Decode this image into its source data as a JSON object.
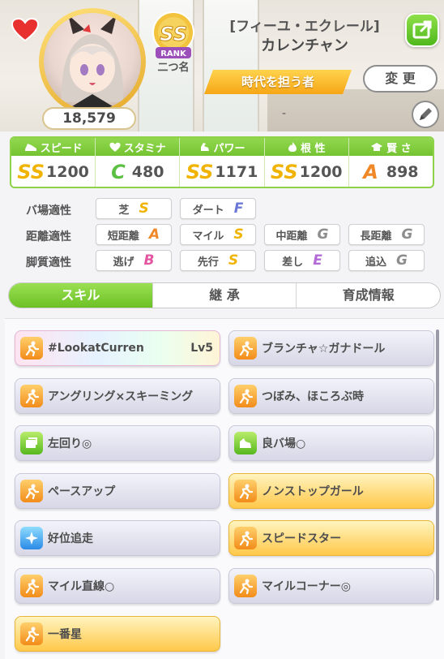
{
  "header": {
    "fans": "18,579",
    "rank_badge_text": "SS",
    "rank_sub_text": "RANK",
    "rank_label": "二つ名",
    "costume": "[フィーユ・エクレール]",
    "name": "カレンチャン",
    "epithet": "時代を担う者",
    "change_label": "変 更",
    "memo": "-"
  },
  "stats": [
    {
      "label": "スピード",
      "grade": "SS",
      "value": "1200",
      "icon": "shoe-icon"
    },
    {
      "label": "スタミナ",
      "grade": "C",
      "value": "480",
      "icon": "heart-icon"
    },
    {
      "label": "パワー",
      "grade": "SS",
      "value": "1171",
      "icon": "muscle-icon"
    },
    {
      "label": "根 性",
      "grade": "SS",
      "value": "1200",
      "icon": "flame-icon"
    },
    {
      "label": "賢 さ",
      "grade": "A",
      "value": "898",
      "icon": "graduation-cap-icon"
    }
  ],
  "aptitude": {
    "track_label": "バ場適性",
    "distance_label": "距離適性",
    "style_label": "脚質適性",
    "track": [
      {
        "name": "芝",
        "grade": "S"
      },
      {
        "name": "ダート",
        "grade": "F"
      }
    ],
    "distance": [
      {
        "name": "短距離",
        "grade": "A"
      },
      {
        "name": "マイル",
        "grade": "S"
      },
      {
        "name": "中距離",
        "grade": "G"
      },
      {
        "name": "長距離",
        "grade": "G"
      }
    ],
    "style": [
      {
        "name": "逃げ",
        "grade": "B"
      },
      {
        "name": "先行",
        "grade": "S"
      },
      {
        "name": "差し",
        "grade": "E"
      },
      {
        "name": "追込",
        "grade": "G"
      }
    ]
  },
  "tabs": [
    "スキル",
    "継 承",
    "育成情報"
  ],
  "skills": [
    {
      "name": "#LookatCurren",
      "level": "Lv5",
      "style": "rainbow",
      "icon": "run-icon"
    },
    {
      "name": "ブランチャ☆ガナドール",
      "level": "",
      "style": "silver",
      "icon": "run-icon"
    },
    {
      "name": "アングリング×スキーミング",
      "level": "",
      "style": "silver",
      "icon": "run-icon"
    },
    {
      "name": "つぼみ、ほころぶ時",
      "level": "",
      "style": "silver",
      "icon": "run-icon"
    },
    {
      "name": "左回り◎",
      "level": "",
      "style": "silver",
      "icon": "track-icon"
    },
    {
      "name": "良バ場○",
      "level": "",
      "style": "silver",
      "icon": "ground-icon"
    },
    {
      "name": "ペースアップ",
      "level": "",
      "style": "silver",
      "icon": "run-icon"
    },
    {
      "name": "ノンストップガール",
      "level": "",
      "style": "gold",
      "icon": "run-icon"
    },
    {
      "name": "好位追走",
      "level": "",
      "style": "silver",
      "icon": "sparkle-icon"
    },
    {
      "name": "スピードスター",
      "level": "",
      "style": "gold",
      "icon": "run-icon"
    },
    {
      "name": "マイル直線○",
      "level": "",
      "style": "silver",
      "icon": "run-icon"
    },
    {
      "name": "マイルコーナー◎",
      "level": "",
      "style": "silver",
      "icon": "run-icon"
    },
    {
      "name": "一番星",
      "level": "",
      "style": "gold",
      "icon": "run-icon"
    }
  ],
  "colors": {
    "accent_green": "#74c332",
    "gold": "#ffc84a",
    "epithet": "#f6a616"
  }
}
